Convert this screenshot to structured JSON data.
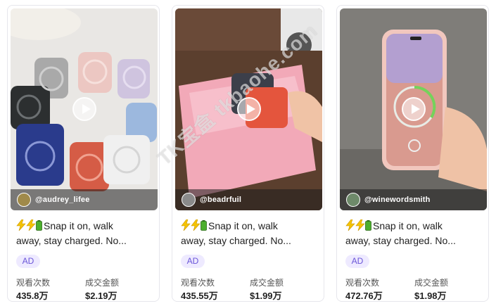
{
  "watermark": "TK宝盒 tkbaohe.com",
  "labels": {
    "views": "观看次数",
    "gmv": "成交金额",
    "ad": "AD"
  },
  "cards": [
    {
      "handle": "@audrey_lifee",
      "desc_line1": "Snap it on, walk",
      "desc_line2": "away, stay charged. No...",
      "views": "435.8万",
      "gmv": "$2.19万"
    },
    {
      "handle": "@beadrfuil",
      "desc_line1": "Snap it on, walk",
      "desc_line2": "away, stay charged. No...",
      "views": "435.55万",
      "gmv": "$1.99万"
    },
    {
      "handle": "@winewordsmith",
      "desc_line1": "Snap it on, walk",
      "desc_line2": "away, stay charged. No...",
      "views": "472.76万",
      "gmv": "$1.98万"
    }
  ],
  "colors": {
    "ad_bg": "#eeeaff",
    "ad_text": "#6a55d8",
    "bolt": "#f5c400",
    "battery": "#4caf2d"
  }
}
